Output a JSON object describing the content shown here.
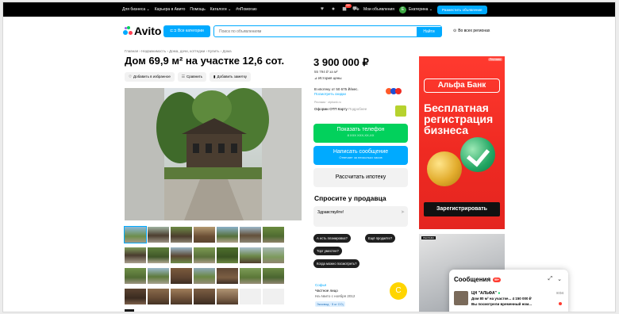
{
  "topbar": {
    "links": [
      "Для бизнеса ⌄",
      "Карьера в Авито",
      "Помощь",
      "Каталоги ⌄",
      "#яПомогаю"
    ],
    "notif_badge": "99+",
    "my_ads": "Мои объявления",
    "user_initial": "Е",
    "user_name": "Екатерина ⌄",
    "post_button": "Разместить объявление"
  },
  "header": {
    "logo_text": "Avito",
    "categories_button": "⊏⊐ Все категории",
    "search_placeholder": "Поиск по объявлениям",
    "search_button": "Найти",
    "region": "Во всех регионах"
  },
  "breadcrumb": "Главная › Недвижимость › Дома, дачи, коттеджи › Купить › Дома",
  "title": "Дом 69,9 м² на участке 12,6 сот.",
  "actions": [
    {
      "icon": "heart-icon",
      "glyph": "♡",
      "label": "Добавить в избранное"
    },
    {
      "icon": "compare-icon",
      "glyph": "☷",
      "label": "Сравнить"
    },
    {
      "icon": "note-icon",
      "glyph": "▮",
      "label": "Добавить заметку"
    }
  ],
  "price": {
    "value": "3 900 000 ₽",
    "per_m": "55 794 ₽ за м²",
    "history": "История цены",
    "credit_line1": "В ипотеку от 50 675 ₽/мес.",
    "credit_link": "Посмотреть скидки",
    "ad_marker": "Реклама · otpbank.ru",
    "otp_text": "Оформи ОТП Карту",
    "otp_more": "Подробнее"
  },
  "buttons": {
    "show_phone": "Показать телефон",
    "phone_mask": "8 XXX XXX-XX-XX",
    "write_msg": "Написать сообщение",
    "write_sub": "Отвечает за несколько часов",
    "mortgage": "Рассчитать ипотеку"
  },
  "ask": {
    "title": "Спросите у продавца",
    "input_value": "Здравствуйте!",
    "chips": [
      "А есть планировка?",
      "Ещё продаёте?",
      "Торг уместен?",
      "Когда можно посмотреть?"
    ]
  },
  "seller": {
    "name": "Софья",
    "type": "Частное лицо",
    "since": "На Авито с ноября 2012",
    "eco": "Экосвод · 5 кг CO₂",
    "avatar_letter": "С"
  },
  "ad": {
    "label": "Реклама",
    "bank": "Альфа Банк",
    "text_lines": [
      "Бесплатная",
      "регистрация",
      "бизнеса"
    ],
    "button": "Зарегистрировать",
    "ad2_label": "РЕКЛАМА"
  },
  "messages": {
    "title": "Сообщения",
    "badge": "99+",
    "from": "ЦН \"АЛЬФА\"",
    "time": "8:04",
    "line2": "Дом 80 м² на участке...",
    "price2": "4 150 000 ₽",
    "line3": "Вы посмотрели временный ном..."
  },
  "colors": {
    "accent": "#00aaff",
    "green": "#02d15c",
    "alfa_red": "#ef2a22"
  }
}
